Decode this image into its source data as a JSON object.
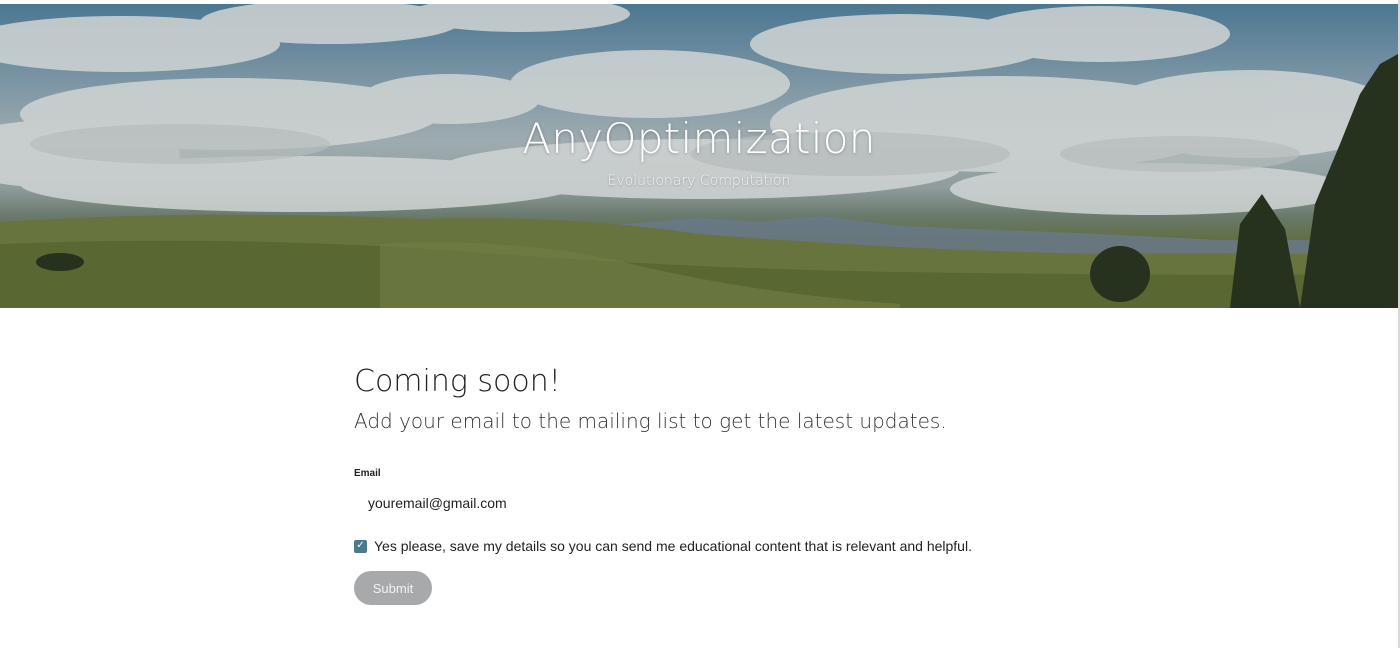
{
  "hero": {
    "title": "AnyOptimization",
    "subtitle": "Evolutionary Computation"
  },
  "main": {
    "heading": "Coming soon!",
    "subheading": "Add your email to the mailing list to get the latest updates."
  },
  "form": {
    "email_label": "Email",
    "email_value": "youremail@gmail.com",
    "consent_checked": true,
    "consent_text": "Yes please, save my details so you can send me educational content that is relevant and helpful.",
    "submit_label": "Submit"
  },
  "colors": {
    "checkbox": "#4b7a8c",
    "submit_bg": "#a7a9aa"
  }
}
